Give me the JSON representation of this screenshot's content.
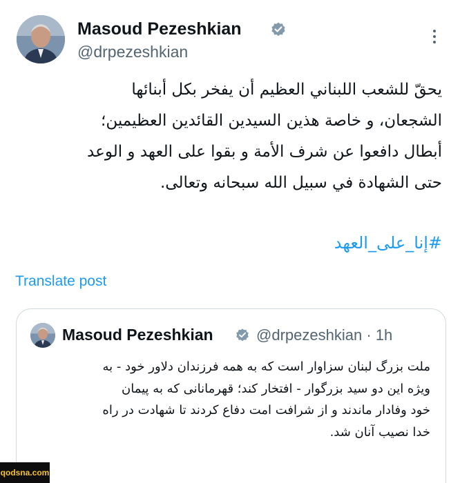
{
  "post": {
    "author": {
      "name": "Masoud Pezeshkian",
      "handle": "@drpezeshkian",
      "verified": true
    },
    "text_lines": [
      "يحقّ للشعب اللبناني العظيم أن يفخر بكل أبنائها",
      "الشجعان، و خاصة هذين السيدين القائدين العظيمين؛",
      "أبطال دافعوا عن شرف الأمة و بقوا على العهد و الوعد",
      "حتى الشهادة في سبيل الله سبحانه وتعالى."
    ],
    "hashtag": "#إنا_على_العهد",
    "translate_label": "Translate post",
    "more_icon": "more-horizontal-icon"
  },
  "quote": {
    "author": {
      "name": "Masoud Pezeshkian",
      "handle": "@drpezeshkian",
      "time": "· 1h"
    },
    "text_lines": [
      "ملت بزرگ لبنان سزاوار است که به همه فرزندان دلاور خود - به",
      "ویژه این دو سید بزرگوار - افتخار کند؛ قهرمانانی که به پیمان",
      "خود وفادار ماندند و از شرافت امت دفاع کردند تا شهادت در راه",
      "خدا نصیب آنان شد."
    ]
  },
  "watermark": "qodsna.com",
  "colors": {
    "accent": "#1d9bf0",
    "text": "#0f1419",
    "muted": "#536471",
    "border": "#cfd9de",
    "verified": "#829aab"
  }
}
